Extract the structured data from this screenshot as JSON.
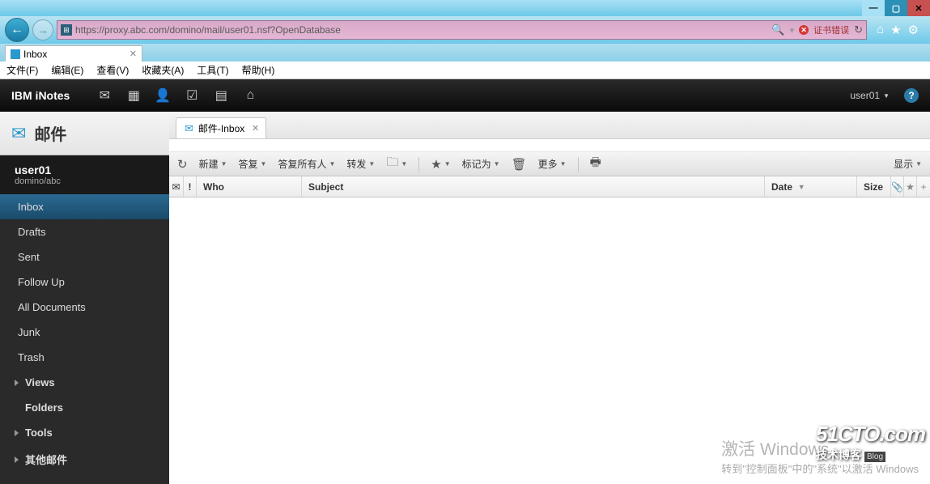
{
  "window": {
    "min": "—",
    "max": "▢",
    "close": "✕"
  },
  "browser": {
    "back": "←",
    "forward": "→",
    "url": "https://proxy.abc.com/domino/mail/user01.nsf?OpenDatabase",
    "cert_error": "证书错误",
    "tab": {
      "title": "Inbox"
    }
  },
  "menubar": [
    "文件(F)",
    "编辑(E)",
    "查看(V)",
    "收藏夹(A)",
    "工具(T)",
    "帮助(H)"
  ],
  "app": {
    "title": "IBM iNotes",
    "user": "user01"
  },
  "sidebar": {
    "title": "邮件",
    "user": "user01",
    "domain": "domino/abc",
    "folders": [
      "Inbox",
      "Drafts",
      "Sent",
      "Follow Up",
      "All Documents",
      "Junk",
      "Trash"
    ],
    "sections": [
      "Views",
      "Folders",
      "Tools",
      "其他邮件"
    ]
  },
  "main": {
    "tab": "邮件-Inbox",
    "toolbar": {
      "new": "新建",
      "reply": "答复",
      "reply_all": "答复所有人",
      "forward": "转发",
      "mark_as": "标记为",
      "more": "更多",
      "display": "显示"
    },
    "columns": {
      "who": "Who",
      "subject": "Subject",
      "date": "Date",
      "size": "Size"
    }
  },
  "watermark": {
    "title": "激活 Windows",
    "sub": "转到\"控制面板\"中的\"系统\"以激活 Windows"
  },
  "cto": {
    "big": "51CTO.com",
    "sub": "技术博客",
    "blog": "Blog"
  }
}
